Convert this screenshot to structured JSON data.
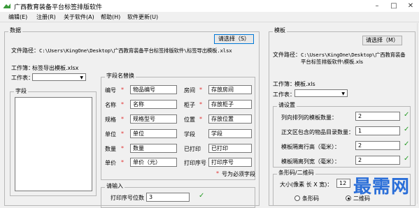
{
  "window": {
    "title": "广西教育装备平台标签排版软件"
  },
  "menu": [
    "编辑(E)",
    "注册(R)",
    "关于软件(A)",
    "帮助(H)",
    "软件更新(U)"
  ],
  "data_group": {
    "legend": "数据",
    "select_button": "请选择（S）",
    "file_path_label": "文件路径：",
    "file_path_value": "C:\\Users\\KingOne\\Desktop\\广西教育装备平台标签排版软件\\标签导出模板.xlsx",
    "workbook_label": "工作簿：",
    "workbook_value": "标签导出模板.xlsx",
    "sheet_label": "工作表："
  },
  "field_group": {
    "legend": "字段"
  },
  "names_group": {
    "legend": "字段名替换",
    "rows_left": [
      {
        "label": "编号",
        "value": "物品编号"
      },
      {
        "label": "名称",
        "value": "名称"
      },
      {
        "label": "规格",
        "value": "规格型号"
      },
      {
        "label": "单位",
        "value": "单位"
      },
      {
        "label": "数量",
        "value": "数量"
      },
      {
        "label": "单价",
        "value": "单价（元）"
      }
    ],
    "rows_right": [
      {
        "label": "房间",
        "value": "存放房间",
        "star": "*"
      },
      {
        "label": "柜子",
        "value": "存放柜子",
        "star": "*"
      },
      {
        "label": "位置",
        "value": "存放位置",
        "star": "*"
      },
      {
        "label": "学段",
        "value": "学段",
        "star": ""
      },
      {
        "label": "已打印",
        "value": "已打印",
        "star": ""
      },
      {
        "label": "打印序号",
        "value": "打印序号",
        "star": ""
      }
    ],
    "required_note": "号为必须字段",
    "star": "*"
  },
  "input_group": {
    "legend": "请输入",
    "digits_label": "打印序号位数",
    "digits_value": "3",
    "check": "✓"
  },
  "template_group": {
    "legend": "模板",
    "select_button": "请选择（M）",
    "file_path_label": "文件路径：",
    "file_path_line1": "C:\\Users\\KingOne\\Desktop\\广西教育装备",
    "file_path_line2": "平台标签排版软件\\模板.xls",
    "workbook_label": "工作簿：",
    "workbook_value": "模板.xls",
    "sheet_label": "工作表："
  },
  "settings_group": {
    "legend": "请设置",
    "rows": [
      {
        "label": "列向排列的模板数量：",
        "value": "2"
      },
      {
        "label": "正文区包含的物品目录数量：",
        "value": "1"
      },
      {
        "label": "模板隔离行高（毫米）：",
        "value": "2"
      },
      {
        "label": "模板隔离列宽（毫米）：",
        "value": "2"
      }
    ],
    "check": "✓"
  },
  "barcode_group": {
    "legend": "条形码/二维码",
    "size_label": "大小(像素 长 X 宽)：",
    "size_value": "12",
    "radio_barcode": "条形码",
    "radio_qrcode": "二维码"
  },
  "watermark": "最需网",
  "colors": {
    "accent": "#0078d7",
    "star": "#e03030",
    "check": "#2a9d2a",
    "watermark": "#2a6ed8"
  }
}
